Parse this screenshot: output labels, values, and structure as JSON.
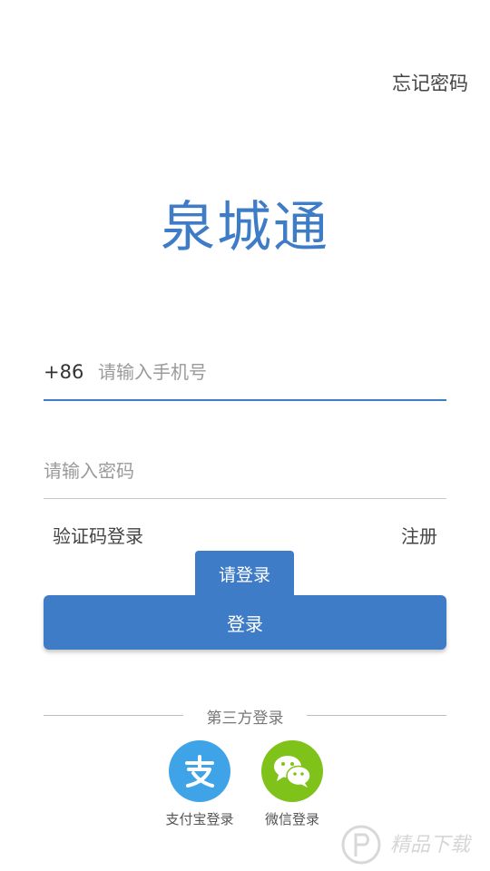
{
  "header": {
    "forgot_password": "忘记密码"
  },
  "app": {
    "title": "泉城通"
  },
  "phone": {
    "country_code": "+86",
    "placeholder": "请输入手机号",
    "value": ""
  },
  "password": {
    "placeholder": "请输入密码",
    "value": ""
  },
  "links": {
    "sms_login": "验证码登录",
    "register": "注册"
  },
  "tooltip": {
    "text": "请登录"
  },
  "login_button": {
    "label": "登录"
  },
  "third_party": {
    "label": "第三方登录",
    "items": [
      {
        "label": "支付宝登录",
        "icon": "alipay-icon",
        "color": "#3fa3e8"
      },
      {
        "label": "微信登录",
        "icon": "wechat-icon",
        "color": "#7fc31a"
      }
    ]
  },
  "watermark": {
    "icon": "jingpin-logo-icon",
    "text": "精品下载"
  },
  "colors": {
    "accent": "#3f7cc8"
  }
}
